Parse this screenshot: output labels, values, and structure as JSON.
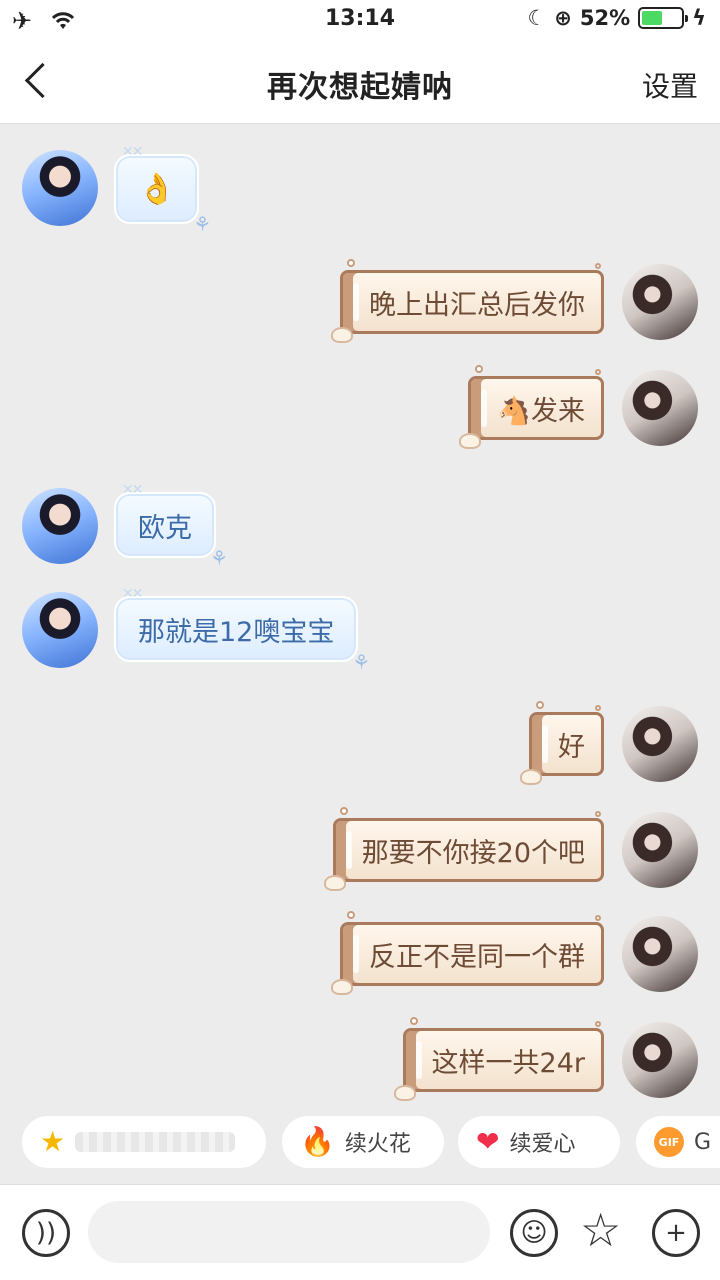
{
  "status_bar": {
    "time": "13:14",
    "battery": "52%",
    "battery_fraction": 0.52
  },
  "header": {
    "title": "再次想起婧呐",
    "settings_label": "设置"
  },
  "messages": [
    {
      "side": "left",
      "text": "👌"
    },
    {
      "side": "right",
      "text": "晚上出汇总后发你"
    },
    {
      "side": "right",
      "text": "🐴发来"
    },
    {
      "side": "left",
      "text": "欧克"
    },
    {
      "side": "left",
      "text": "那就是12噢宝宝"
    },
    {
      "side": "right",
      "text": "好"
    },
    {
      "side": "right",
      "text": "那要不你接20个吧"
    },
    {
      "side": "right",
      "text": "反正不是同一个群"
    },
    {
      "side": "right",
      "text": "这样一共24r"
    }
  ],
  "quick_actions": [
    {
      "icon": "star-icon",
      "label": ""
    },
    {
      "icon": "fire-icon",
      "label": "续火花"
    },
    {
      "icon": "heart-icon",
      "label": "续爱心"
    },
    {
      "icon": "gif-icon",
      "label": "G"
    }
  ],
  "input": {
    "placeholder": ""
  }
}
